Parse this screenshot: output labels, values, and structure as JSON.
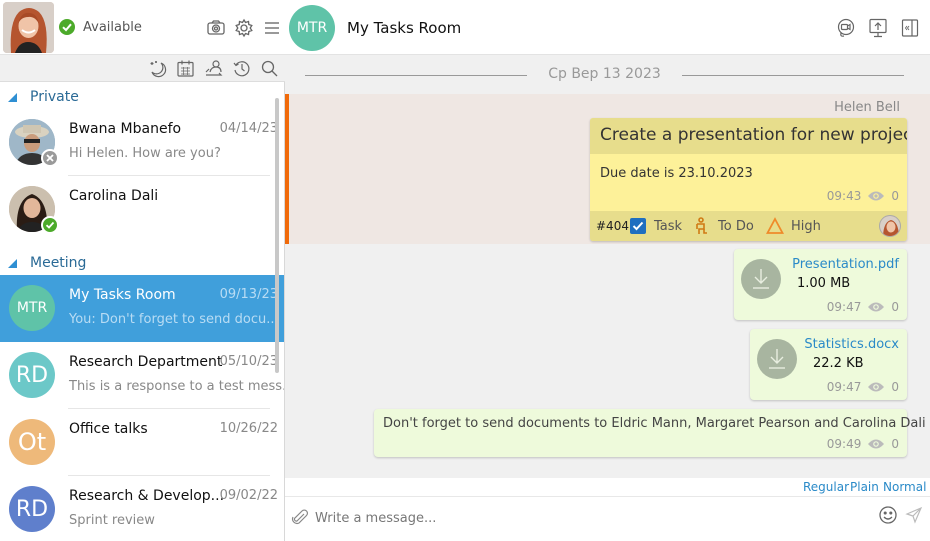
{
  "user": {
    "status": "Available",
    "status_color": "#4caa2a"
  },
  "header_icons": [
    "camera-icon",
    "gear-icon",
    "menu-icon"
  ],
  "tool_icons": [
    "dnd-moon-icon",
    "calendar-icon",
    "contacts-transfer-icon",
    "history-icon",
    "search-icon"
  ],
  "groups": {
    "private": "Private",
    "meeting": "Meeting"
  },
  "chats": [
    {
      "name": "Bwana Mbanefo",
      "date": "04/14/23",
      "preview": "Hi Helen. How are you?",
      "status": "offline"
    },
    {
      "name": "Carolina Dali",
      "date": "",
      "preview": "",
      "status": "available"
    },
    {
      "initials": "MTR",
      "name": "My Tasks Room",
      "date": "09/13/23",
      "preview": "You: Don't forget to send docu...",
      "color": "#5fc3a8",
      "selected": true
    },
    {
      "initials": "RD",
      "name": "Research Department",
      "date": "05/10/23",
      "preview": "This is a response to a test mess...",
      "color": "#6cc8c8"
    },
    {
      "initials": "Ot",
      "name": "Office talks",
      "date": "10/26/22",
      "preview": "",
      "color": "#eeb97a"
    },
    {
      "initials": "RD",
      "name": "Research & Develop...",
      "date": "09/02/22",
      "preview": "Sprint review",
      "color": "#5f7fcc"
    }
  ],
  "room": {
    "initials": "MTR",
    "title": "My Tasks Room",
    "icons": [
      "video-call-icon",
      "screen-share-icon",
      "collapse-panel-icon"
    ]
  },
  "date_separator": "Cp Bep 13 2023",
  "task": {
    "sender": "Helen Bell",
    "title": "Create a presentation for new project",
    "description": "Due date is 23.10.2023",
    "time": "09:43",
    "views": "0",
    "id": "#404",
    "type": "Task",
    "status": "To Do",
    "priority": "High",
    "accent_color": "#f06a0a"
  },
  "files": [
    {
      "name": "Presentation.pdf",
      "size": "1.00 MB",
      "time": "09:47",
      "views": "0"
    },
    {
      "name": "Statistics.docx",
      "size": "22.2 KB",
      "time": "09:47",
      "views": "0"
    }
  ],
  "text_message": {
    "body": "Don't forget to send documents to Eldric Mann, Margaret Pearson and Carolina Dali",
    "time": "09:49",
    "views": "0"
  },
  "format": {
    "style": "Regular",
    "mode": "Plain",
    "size": "Normal"
  },
  "compose": {
    "placeholder": "Write a message..."
  }
}
